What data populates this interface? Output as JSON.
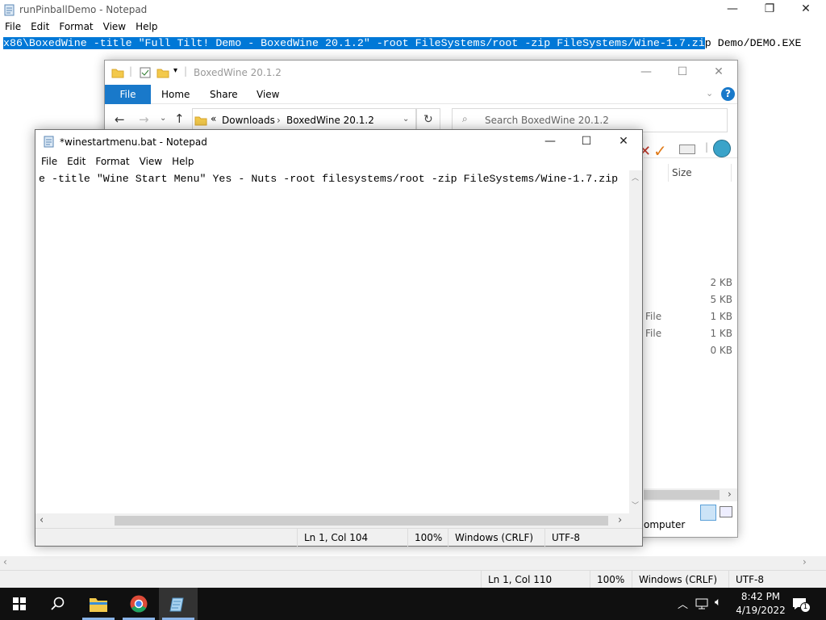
{
  "background_notepad": {
    "title": "runPinballDemo - Notepad",
    "menu": [
      "File",
      "Edit",
      "Format",
      "View",
      "Help"
    ],
    "text_selected": "x86\\BoxedWine -title \"Full Tilt! Demo - BoxedWine 20.1.2\" -root FileSystems/root -zip FileSystems/Wine-1.7.zi",
    "text_rest": "p Demo/DEMO.EXE",
    "status": {
      "position": "Ln 1, Col 110",
      "zoom": "100%",
      "line_ending": "Windows (CRLF)",
      "encoding": "UTF-8"
    }
  },
  "explorer": {
    "title": "BoxedWine 20.1.2",
    "ribbon_tabs": [
      "File",
      "Home",
      "Share",
      "View"
    ],
    "breadcrumb_prefix": "«",
    "breadcrumb": [
      "Downloads",
      "BoxedWine 20.1.2"
    ],
    "search_placeholder": "Search BoxedWine 20.1.2",
    "column_size": "Size",
    "rows": [
      {
        "type": "",
        "size": "2 KB"
      },
      {
        "type": "",
        "size": "5 KB"
      },
      {
        "type": "File",
        "size": "1 KB"
      },
      {
        "type": "File",
        "size": "1 KB"
      },
      {
        "type": "",
        "size": "0 KB"
      }
    ],
    "nav_partial": "omputer"
  },
  "front_notepad": {
    "title": "*winestartmenu.bat - Notepad",
    "menu": [
      "File",
      "Edit",
      "Format",
      "View",
      "Help"
    ],
    "text": "e -title \"Wine Start Menu\" Yes - Nuts -root filesystems/root -zip FileSystems/Wine-1.7.zip",
    "status": {
      "position": "Ln 1, Col 104",
      "zoom": "100%",
      "line_ending": "Windows (CRLF)",
      "encoding": "UTF-8"
    }
  },
  "taskbar": {
    "time": "8:42 PM",
    "date": "4/19/2022",
    "notification_count": "1"
  },
  "colors": {
    "selection": "#0078d7",
    "ribbon_file": "#1979ca",
    "taskbar": "#101010"
  }
}
